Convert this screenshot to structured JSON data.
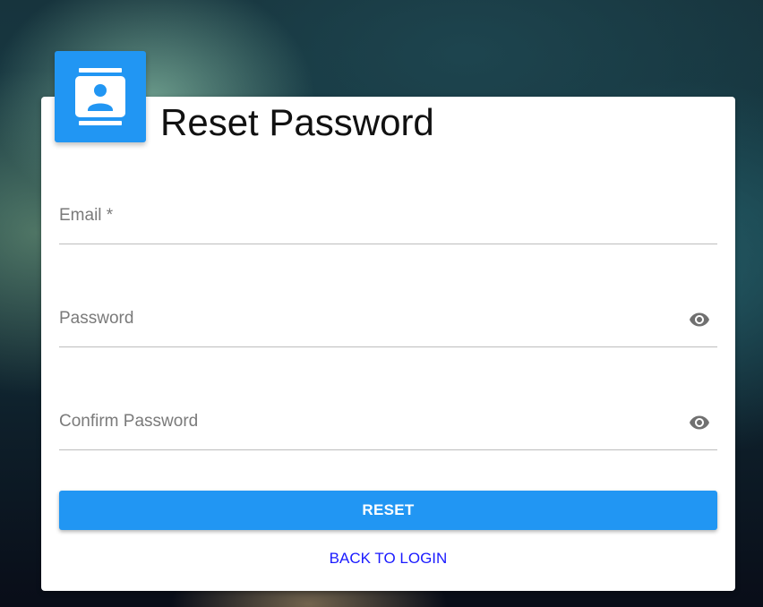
{
  "form": {
    "title": "Reset Password",
    "fields": {
      "email": {
        "label": "Email *",
        "value": ""
      },
      "password": {
        "label": "Password",
        "value": ""
      },
      "confirm_password": {
        "label": "Confirm Password",
        "value": ""
      }
    },
    "reset_label": "RESET",
    "back_label": "BACK TO LOGIN"
  },
  "icons": {
    "badge": "contact-card-icon",
    "toggle_visibility": "eye-icon"
  },
  "colors": {
    "primary": "#2196f3",
    "link": "#1a1aff",
    "card_background": "#ffffff"
  }
}
